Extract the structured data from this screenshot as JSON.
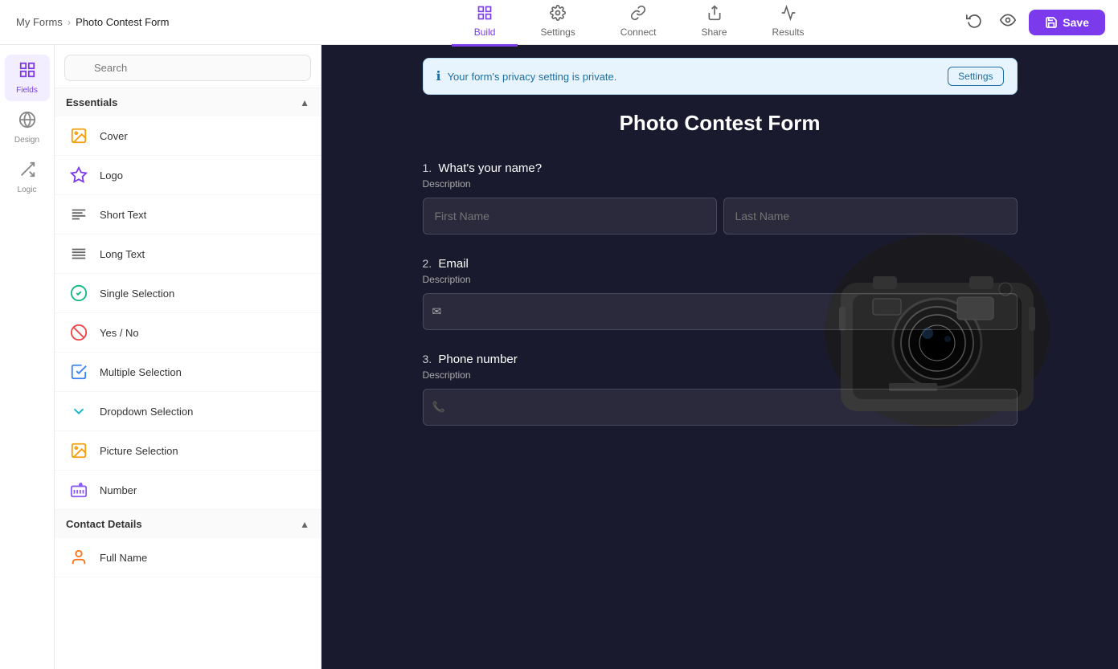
{
  "breadcrumb": {
    "parent": "My Forms",
    "separator": "›",
    "current": "Photo Contest Form"
  },
  "nav_tabs": [
    {
      "id": "build",
      "label": "Build",
      "icon": "🔧",
      "active": true
    },
    {
      "id": "settings",
      "label": "Settings",
      "icon": "⚙️",
      "active": false
    },
    {
      "id": "connect",
      "label": "Connect",
      "icon": "🔗",
      "active": false
    },
    {
      "id": "share",
      "label": "Share",
      "icon": "↗️",
      "active": false
    },
    {
      "id": "results",
      "label": "Results",
      "icon": "📊",
      "active": false
    }
  ],
  "save_button": "Save",
  "sidebar_items": [
    {
      "id": "fields",
      "label": "Fields",
      "active": true
    },
    {
      "id": "design",
      "label": "Design",
      "active": false
    },
    {
      "id": "logic",
      "label": "Logic",
      "active": false
    }
  ],
  "search_placeholder": "Search",
  "essentials_section": {
    "label": "Essentials",
    "items": [
      {
        "id": "cover",
        "label": "Cover",
        "type": "cover"
      },
      {
        "id": "logo",
        "label": "Logo",
        "type": "logo"
      },
      {
        "id": "short-text",
        "label": "Short Text",
        "type": "short"
      },
      {
        "id": "long-text",
        "label": "Long Text",
        "type": "long"
      },
      {
        "id": "single-selection",
        "label": "Single Selection",
        "type": "single"
      },
      {
        "id": "yes-no",
        "label": "Yes / No",
        "type": "yesno"
      },
      {
        "id": "multiple-selection",
        "label": "Multiple Selection",
        "type": "multi"
      },
      {
        "id": "dropdown-selection",
        "label": "Dropdown Selection",
        "type": "dropdown"
      },
      {
        "id": "picture-selection",
        "label": "Picture Selection",
        "type": "picture"
      },
      {
        "id": "number",
        "label": "Number",
        "type": "number"
      }
    ]
  },
  "contact_section": {
    "label": "Contact Details",
    "items": [
      {
        "id": "full-name",
        "label": "Full Name",
        "type": "fullname"
      }
    ]
  },
  "privacy_banner": {
    "message": "Your form's privacy setting is private.",
    "settings_btn": "Settings"
  },
  "form": {
    "title": "Photo Contest Form",
    "questions": [
      {
        "num": "1.",
        "label": "What's your name?",
        "description": "Description",
        "type": "name",
        "inputs": [
          {
            "placeholder": "First Name"
          },
          {
            "placeholder": "Last Name"
          }
        ]
      },
      {
        "num": "2.",
        "label": "Email",
        "description": "Description",
        "type": "email",
        "icon": "✉"
      },
      {
        "num": "3.",
        "label": "Phone number",
        "description": "Description",
        "type": "phone",
        "icon": "📞"
      }
    ]
  }
}
